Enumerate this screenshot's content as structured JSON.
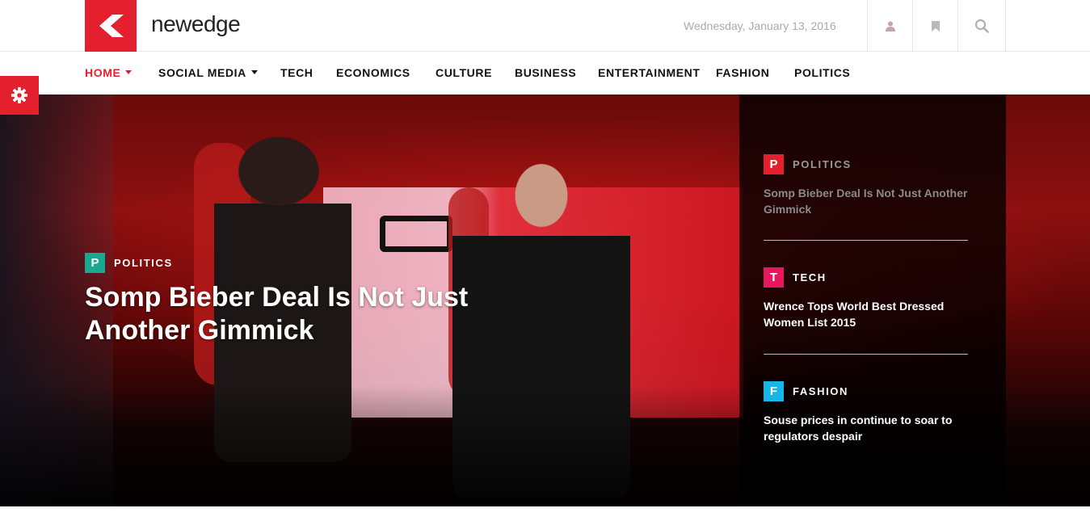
{
  "header": {
    "brand": "newedge",
    "date": "Wednesday, January 13, 2016",
    "icons": [
      "user-icon",
      "bookmark-icon",
      "search-icon"
    ]
  },
  "nav": {
    "items": [
      {
        "label": "HOME",
        "active": true,
        "dropdown": true
      },
      {
        "label": "SOCIAL MEDIA",
        "active": false,
        "dropdown": true
      },
      {
        "label": "TECH",
        "active": false,
        "dropdown": false
      },
      {
        "label": "ECONOMICS",
        "active": false,
        "dropdown": false
      },
      {
        "label": "CULTURE",
        "active": false,
        "dropdown": false
      },
      {
        "label": "BUSINESS",
        "active": false,
        "dropdown": false
      },
      {
        "label": "ENTERTAINMENT",
        "active": false,
        "dropdown": false
      },
      {
        "label": "FASHION",
        "active": false,
        "dropdown": false
      },
      {
        "label": "POLITICS",
        "active": false,
        "dropdown": false
      }
    ]
  },
  "settings": {
    "icon": "gear-icon"
  },
  "hero": {
    "category_letter": "P",
    "category": "POLITICS",
    "title": "Somp Bieber Deal Is Not Just Another Gimmick"
  },
  "side": {
    "items": [
      {
        "letter": "P",
        "category": "POLITICS",
        "title": "Somp Bieber Deal Is Not Just Another Gimmick",
        "color": "#e5202e",
        "dim": true
      },
      {
        "letter": "T",
        "category": "TECH",
        "title": "Wrence Tops World Best Dressed Women List 2015",
        "color": "#e8165f",
        "dim": false
      },
      {
        "letter": "F",
        "category": "FASHION",
        "title": "Souse prices in continue to soar to regulators despair",
        "color": "#16b6e8",
        "dim": false
      }
    ]
  },
  "colors": {
    "accent": "#e5202e",
    "politics_teal": "#17a991"
  }
}
